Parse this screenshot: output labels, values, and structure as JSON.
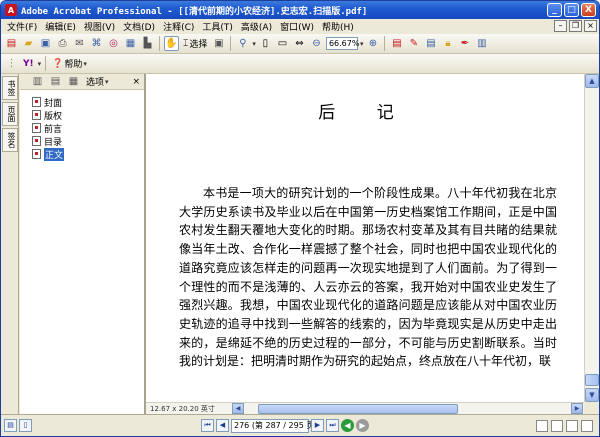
{
  "window": {
    "title": "Adobe Acrobat Professional - [[清代前期的小农经济].史志宏.扫描版.pdf]",
    "minimize_label": "_",
    "maximize_label": "□",
    "close_label": "X"
  },
  "menu": {
    "items": [
      "文件(F)",
      "编辑(E)",
      "视图(V)",
      "文档(D)",
      "注释(C)",
      "工具(T)",
      "高级(A)",
      "窗口(W)",
      "帮助(H)"
    ]
  },
  "toolbar": {
    "select_label": "选择",
    "zoom_value": "66.67%",
    "help_label": "帮助",
    "acrobat_label": "Y!"
  },
  "nav_panel": {
    "tabs": [
      "书签",
      "页面",
      "签名"
    ],
    "options_label": "选项",
    "bookmarks": [
      {
        "label": "封面",
        "selected": false
      },
      {
        "label": "版权",
        "selected": false
      },
      {
        "label": "前言",
        "selected": false
      },
      {
        "label": "目录",
        "selected": false
      },
      {
        "label": "正文",
        "selected": true
      }
    ]
  },
  "document": {
    "heading": "后  记",
    "paragraph": "本书是一项大的研究计划的一个阶段性成果。八十年代初我在北京大学历史系读书及毕业以后在中国第一历史档案馆工作期间，正是中国农村发生翻天覆地大变化的时期。那场农村变革及其有目共睹的结果就像当年土改、合作化一样震撼了整个社会，同时也把中国农业现代化的道路究竟应该怎样走的问题再一次现实地提到了人们面前。为了得到一个理性的而不是浅薄的、人云亦云的答案，我开始对中国农业史发生了强烈兴趣。我想，中国农业现代化的道路问题是应该能从对中国农业历史轨迹的追寻中找到一些解答的线索的，因为毕竟现实是从历史中走出来的，是绵延不绝的历史过程的一部分，不可能与历史割断联系。当时我的计划是：把明清时期作为研究的起始点，终点放在八十年代初，联"
  },
  "status": {
    "page_size": "12.67 x 20.20 英寸",
    "page_field": "276 (第 287 / 295 页)"
  },
  "colors": {
    "titlebar": "#1f5bd0",
    "selection": "#316ac5",
    "chrome": "#ece9d8"
  }
}
